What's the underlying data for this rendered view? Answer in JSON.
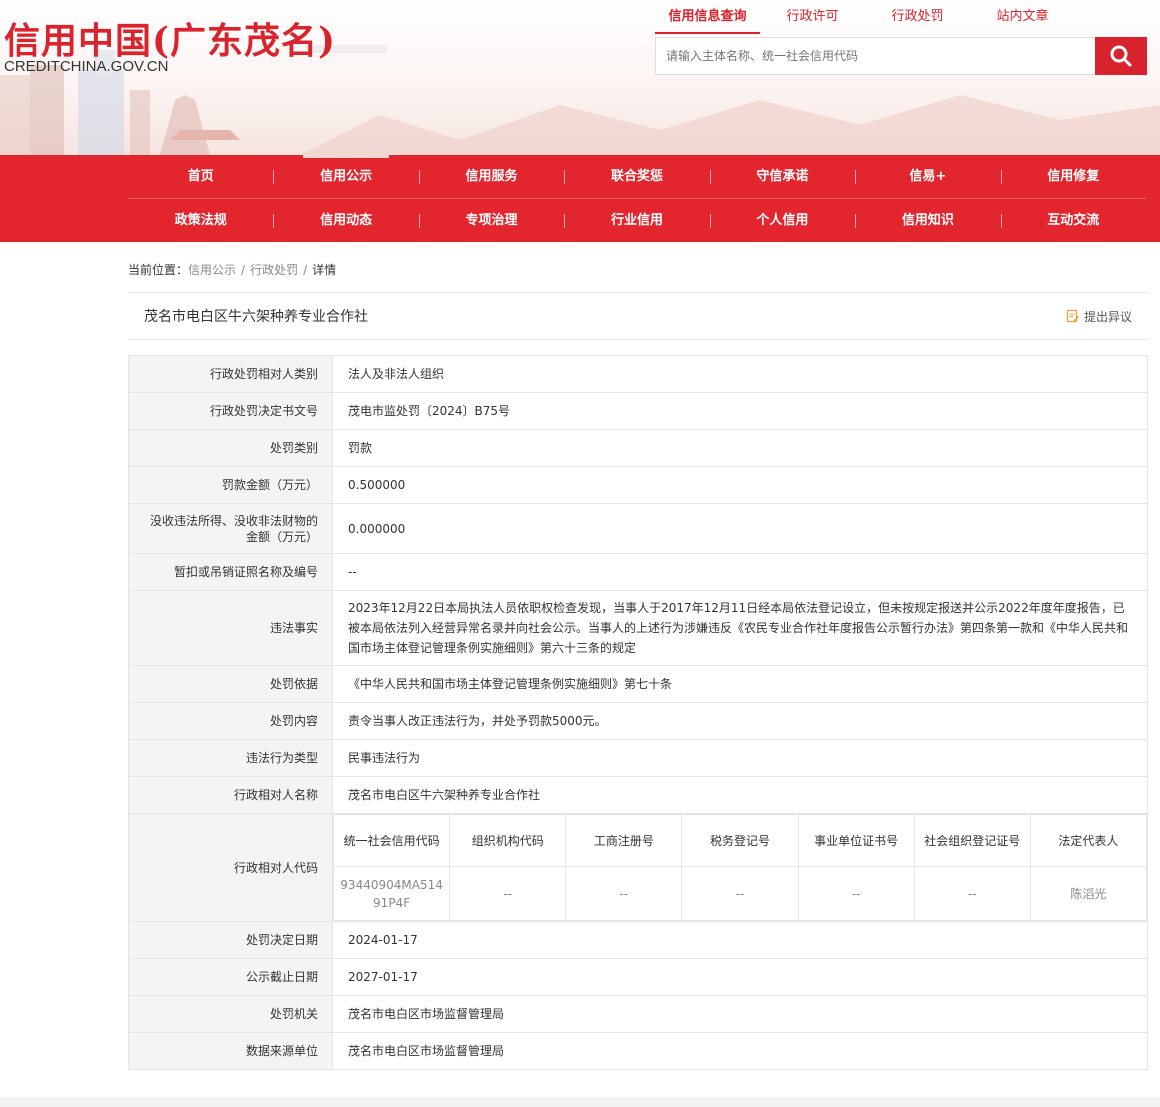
{
  "header": {
    "logo_title": "信用中国(广东茂名)",
    "logo_sub": "CREDITCHINA.GOV.CN",
    "top_nav": [
      "信用信息查询",
      "行政许可",
      "行政处罚",
      "站内文章"
    ],
    "search_placeholder": "请输入主体名称、统一社会信用代码"
  },
  "main_nav": {
    "row1": [
      "首页",
      "信用公示",
      "信用服务",
      "联合奖惩",
      "守信承诺",
      "信易+",
      "信用修复"
    ],
    "row2": [
      "政策法规",
      "信用动态",
      "专项治理",
      "行业信用",
      "个人信用",
      "信用知识",
      "互动交流"
    ]
  },
  "breadcrumb": {
    "prefix": "当前位置：",
    "items": [
      "信用公示",
      "行政处罚",
      "详情"
    ]
  },
  "subject": {
    "name": "茂名市电白区牛六架种养专业合作社",
    "objection_label": "提出异议"
  },
  "detail": {
    "rows": [
      {
        "label": "行政处罚相对人类别",
        "value": "法人及非法人组织"
      },
      {
        "label": "行政处罚决定书文号",
        "value": "茂电市监处罚〔2024〕B75号"
      },
      {
        "label": "处罚类别",
        "value": "罚款"
      },
      {
        "label": "罚款金额（万元）",
        "value": "0.500000"
      },
      {
        "label": "没收违法所得、没收非法财物的金额（万元）",
        "value": "0.000000"
      },
      {
        "label": "暂扣或吊销证照名称及编号",
        "value": "--"
      },
      {
        "label": "违法事实",
        "value": "2023年12月22日本局执法人员依职权检查发现，当事人于2017年12月11日经本局依法登记设立，但未按规定报送并公示2022年度年度报告，已被本局依法列入经营异常名录并向社会公示。当事人的上述行为涉嫌违反《农民专业合作社年度报告公示暂行办法》第四条第一款和《中华人民共和国市场主体登记管理条例实施细则》第六十三条的规定"
      },
      {
        "label": "处罚依据",
        "value": "《中华人民共和国市场主体登记管理条例实施细则》第七十条"
      },
      {
        "label": "处罚内容",
        "value": "责令当事人改正违法行为，并处予罚款5000元。"
      },
      {
        "label": "违法行为类型",
        "value": "民事违法行为"
      },
      {
        "label": "行政相对人名称",
        "value": "茂名市电白区牛六架种养专业合作社"
      }
    ],
    "code_row_label": "行政相对人代码",
    "code_headers": [
      "统一社会信用代码",
      "组织机构代码",
      "工商注册号",
      "税务登记号",
      "事业单位证书号",
      "社会组织登记证号",
      "法定代表人"
    ],
    "code_values": [
      "93440904MA51491P4F",
      "--",
      "--",
      "--",
      "--",
      "--",
      "陈滔光"
    ],
    "rows_after": [
      {
        "label": "处罚决定日期",
        "value": "2024-01-17"
      },
      {
        "label": "公示截止日期",
        "value": "2027-01-17"
      },
      {
        "label": "处罚机关",
        "value": "茂名市电白区市场监督管理局"
      },
      {
        "label": "数据来源单位",
        "value": "茂名市电白区市场监督管理局"
      }
    ]
  },
  "colors": {
    "brand_red": "#e3252e",
    "label_bg": "#f4f4f4"
  }
}
